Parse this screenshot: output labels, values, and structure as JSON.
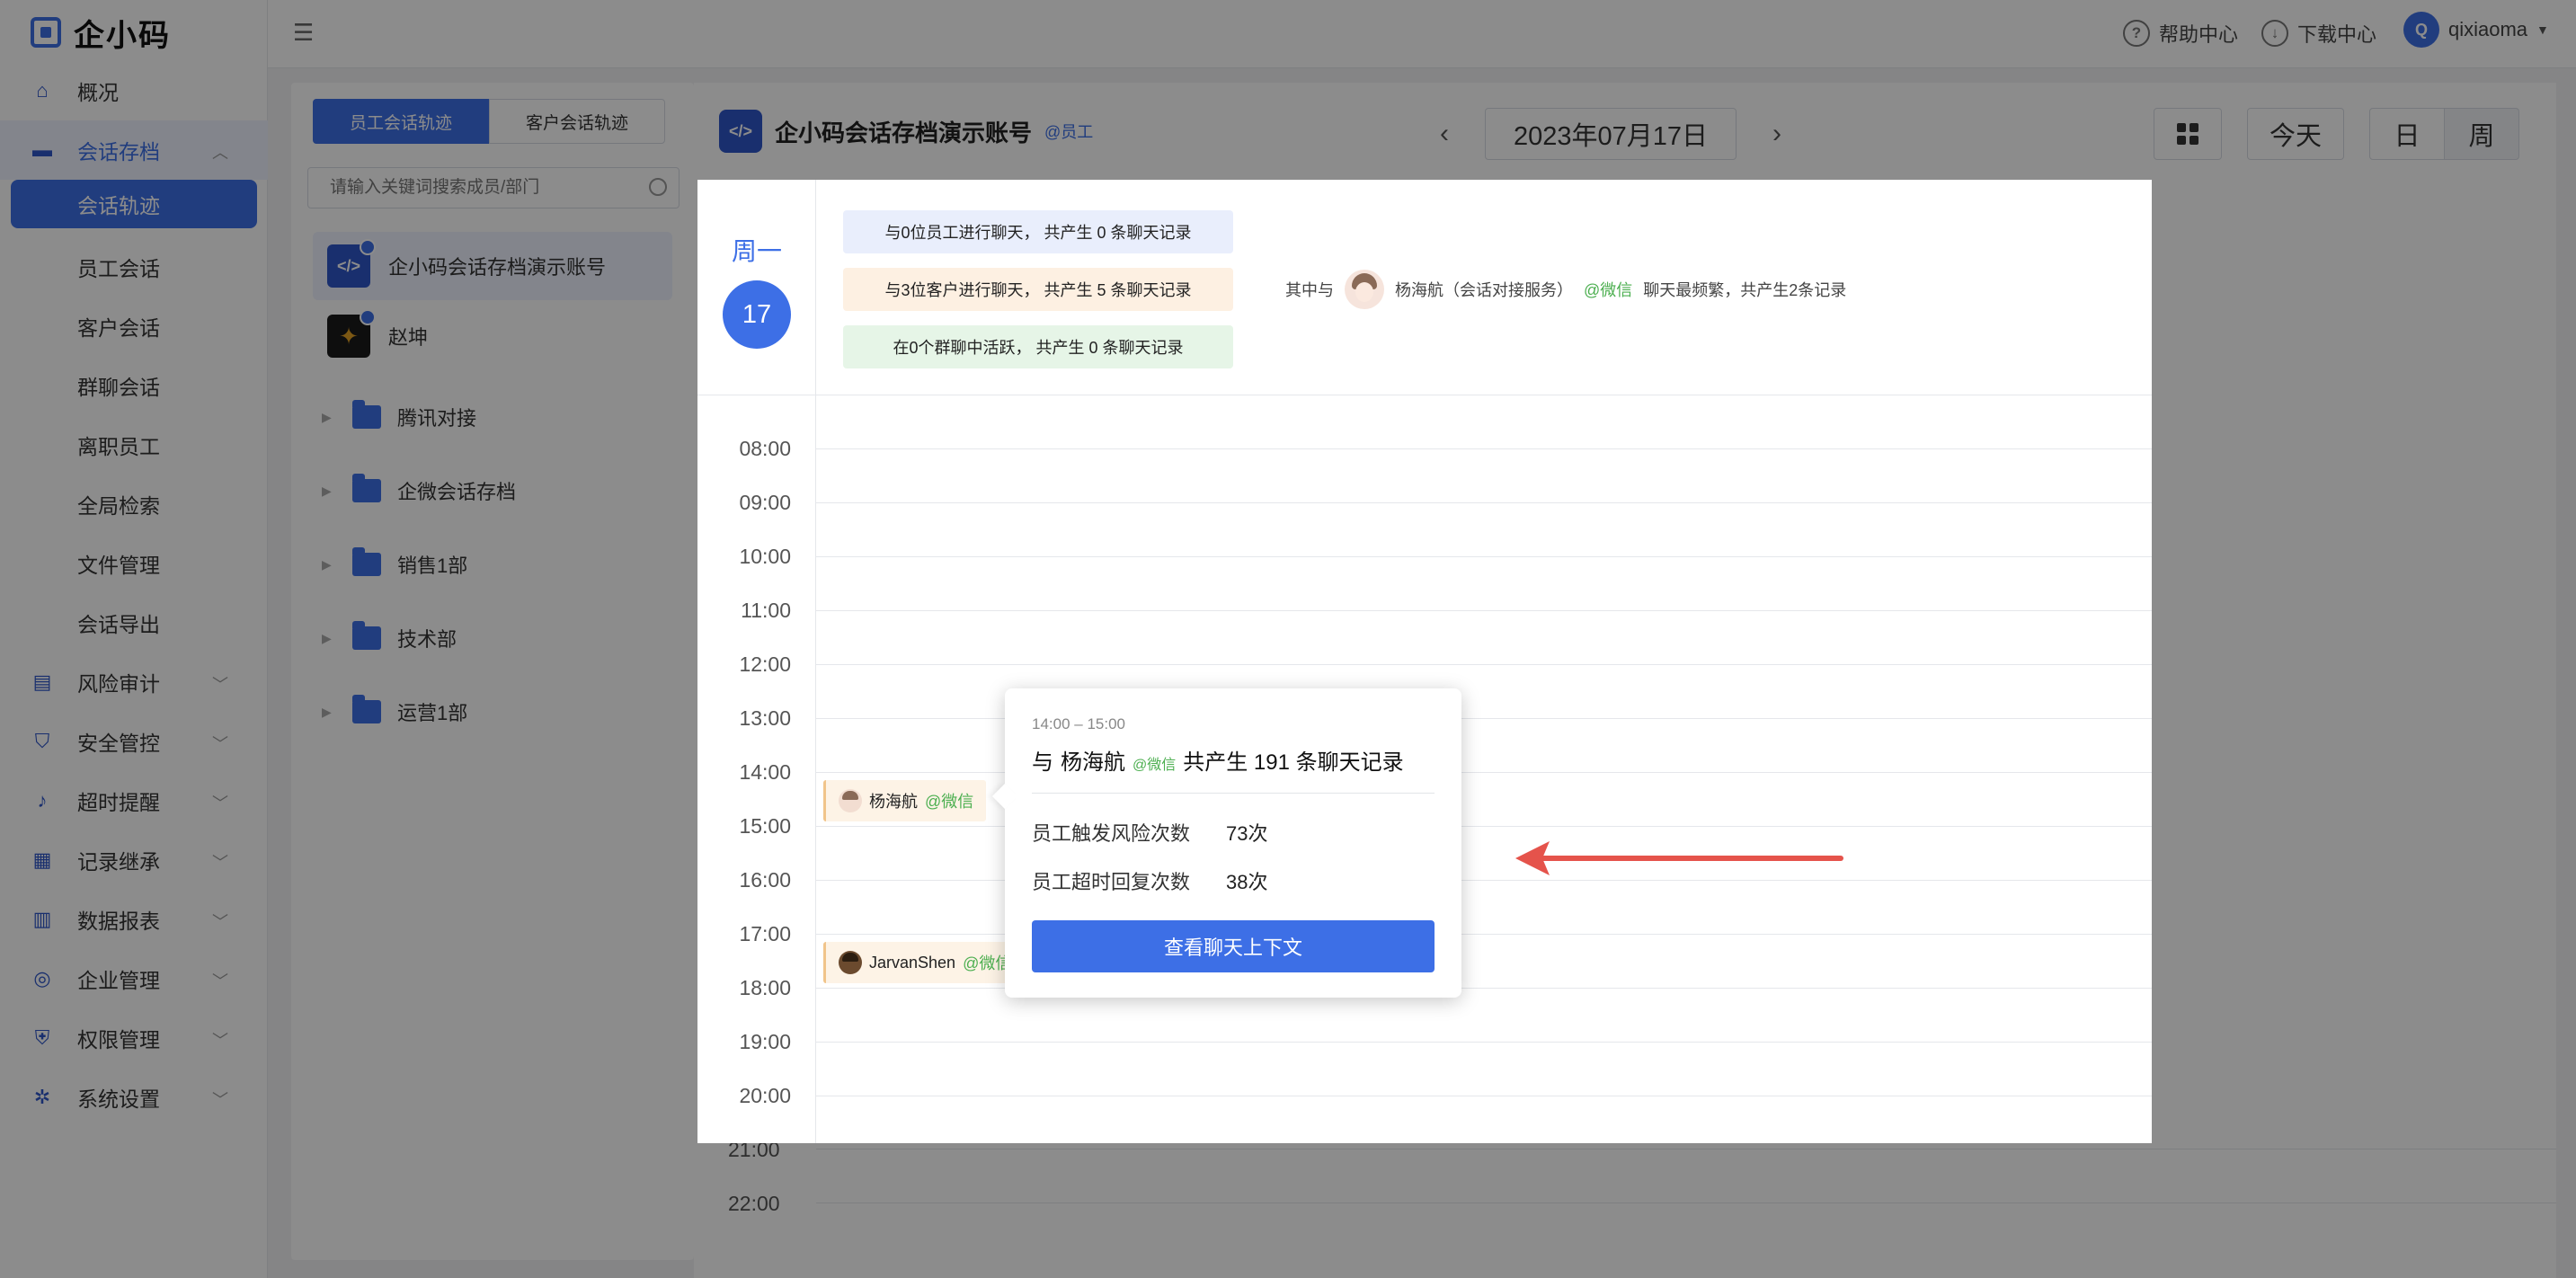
{
  "app": {
    "logo_text": "企小码"
  },
  "sidebar": {
    "items": [
      {
        "label": "概况",
        "icon": "home-icon"
      },
      {
        "label": "会话存档",
        "icon": "folder-icon"
      },
      {
        "label": "会话轨迹"
      },
      {
        "label": "员工会话"
      },
      {
        "label": "客户会话"
      },
      {
        "label": "群聊会话"
      },
      {
        "label": "离职员工"
      },
      {
        "label": "全局检索"
      },
      {
        "label": "文件管理"
      },
      {
        "label": "会话导出"
      },
      {
        "label": "风险审计",
        "icon": "audit-icon"
      },
      {
        "label": "安全管控",
        "icon": "shield-icon"
      },
      {
        "label": "超时提醒",
        "icon": "bell-icon"
      },
      {
        "label": "记录继承",
        "icon": "inherit-icon"
      },
      {
        "label": "数据报表",
        "icon": "chart-icon"
      },
      {
        "label": "企业管理",
        "icon": "enterprise-icon"
      },
      {
        "label": "权限管理",
        "icon": "lock-icon"
      },
      {
        "label": "系统设置",
        "icon": "gear-icon"
      }
    ]
  },
  "topbar": {
    "help": "帮助中心",
    "download": "下载中心",
    "username": "qixiaoma",
    "avatar_letter": "Q"
  },
  "left_panel": {
    "tab_employee": "员工会话轨迹",
    "tab_customer": "客户会话轨迹",
    "search_placeholder": "请输入关键词搜索成员/部门",
    "members": [
      {
        "name": "企小码会话存档演示账号"
      },
      {
        "name": "赵坤"
      }
    ],
    "departments": [
      "腾讯对接",
      "企微会话存档",
      "销售1部",
      "技术部",
      "运营1部"
    ]
  },
  "header": {
    "account_name": "企小码会话存档演示账号",
    "account_tag": "@员工",
    "date": "2023年07月17日",
    "today_label": "今天",
    "day_label": "日",
    "week_label": "周"
  },
  "calendar": {
    "weekday": "周一",
    "day_number": "17",
    "summary": {
      "employees": "与0位员工进行聊天， 共产生 0 条聊天记录",
      "customers": "与3位客户进行聊天， 共产生 5 条聊天记录",
      "groups": "在0个群聊中活跃， 共产生 0 条聊天记录"
    },
    "frequent": {
      "prefix": "其中与",
      "name": "杨海航（会话对接服务）",
      "channel": "@微信",
      "suffix": "聊天最频繁，共产生2条记录"
    },
    "times": [
      "08:00",
      "09:00",
      "10:00",
      "11:00",
      "12:00",
      "13:00",
      "14:00",
      "15:00",
      "16:00",
      "17:00",
      "18:00",
      "19:00",
      "20:00",
      "21:00",
      "22:00"
    ],
    "events": [
      {
        "name": "杨海航",
        "channel": "@微信"
      },
      {
        "name": "JarvanShen",
        "channel": "@微信"
      }
    ]
  },
  "popup": {
    "time_range": "14:00 – 15:00",
    "title_prefix": "与",
    "name": "杨海航",
    "channel": "@微信",
    "title_suffix": "共产生 191 条聊天记录",
    "risk_label": "员工触发风险次数",
    "risk_value": "73次",
    "timeout_label": "员工超时回复次数",
    "timeout_value": "38次",
    "button": "查看聊天上下文"
  },
  "colors": {
    "primary": "#3d6fe6",
    "wechat": "#4caf50",
    "annotation": "#e5534b"
  }
}
